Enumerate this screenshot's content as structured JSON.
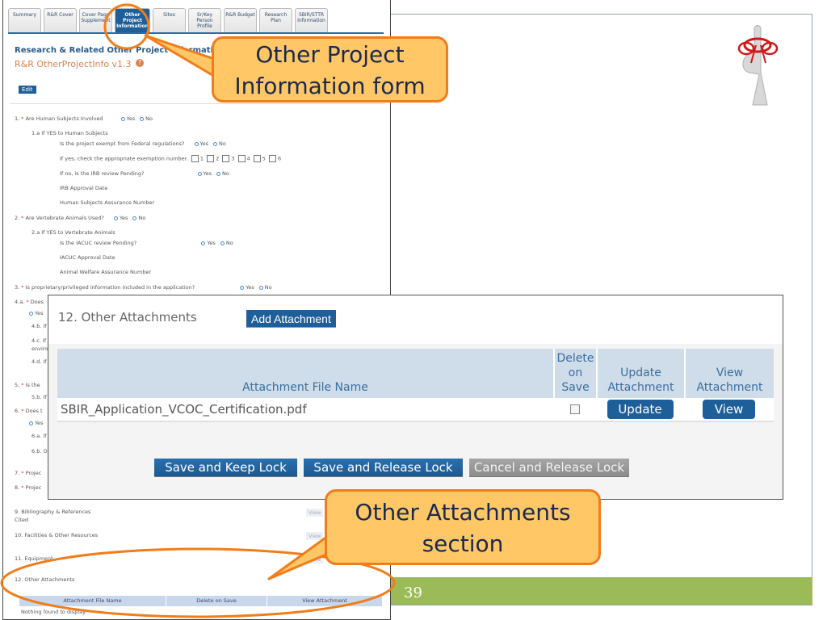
{
  "form": {
    "tabs": [
      {
        "label": "Summary",
        "active": false
      },
      {
        "label": "R&R Cover",
        "active": false
      },
      {
        "label": "Cover Page Supplement",
        "active": false
      },
      {
        "label": "Other Project Information",
        "active": true
      },
      {
        "label": "Sites",
        "active": false
      },
      {
        "label": "Sr/Key Person Profile",
        "active": false
      },
      {
        "label": "R&R Budget",
        "active": false
      },
      {
        "label": "Research Plan",
        "active": false
      },
      {
        "label": "SBIR/STTR Information",
        "active": false
      }
    ],
    "title": "Research & Related Other Project Information",
    "subtitle": "R&R OtherProjectInfo v1.3",
    "help_icon": "?",
    "edit_label": "Edit",
    "yes": "Yes",
    "no": "No",
    "required_mark": "*",
    "questions": {
      "q1": "1.",
      "q1_text": "Are Human Subjects Involved",
      "q1a": "1.a If YES to Human Subjects",
      "q1a_exempt": "Is the project exempt from Federal regulations?",
      "q1a_exemption": "If yes, check the appropriate exemption number.",
      "exemption_numbers": [
        "1",
        "2",
        "3",
        "4",
        "5",
        "6"
      ],
      "q1a_irb": "If no, is the IRB review Pending?",
      "q1a_irb_date": "IRB Approval Date",
      "q1a_assurance": "Human Subjects Assurance Number",
      "q2": "2.",
      "q2_text": "Are Vertebrate Animals Used?",
      "q2a": "2.a If YES to Vertebrate Animals",
      "q2a_iacuc": "Is the IACUC review Pending?",
      "q2a_date": "IACUC Approval Date",
      "q2a_assurance": "Animal Welfare Assurance Number",
      "q3": "3.",
      "q3_text": "Is proprietary/privileged information included in the application?",
      "q4a": "4.a.",
      "q4a_text": "Does",
      "q4a_yes": "Yes",
      "q4b": "4.b. If",
      "q4c": "4.c. If",
      "q4c_2": "enviro",
      "q4d": "4.d. If",
      "q5": "5.",
      "q5_text": "Is the",
      "q5b": "5.b. If",
      "q6": "6.",
      "q6_text": "Does t",
      "q6_yes": "Yes",
      "q6a": "6.a. If",
      "q6b": "6.b. O",
      "q7": "7.",
      "q7_text": "Projec",
      "q8": "8.",
      "q8_text": "Projec",
      "q9": "9. Bibliography & References",
      "q9_2": "Cited",
      "q10": "10. Facilities & Other Resources",
      "q11": "11. Equipment",
      "q12": "12. Other Attachments",
      "view": "View"
    },
    "mini_table": {
      "headers": [
        "Attachment File Name",
        "Delete on Save",
        "View Attachment"
      ],
      "empty": "Nothing found to display."
    }
  },
  "attachments": {
    "title": "12. Other Attachments",
    "add_label": "Add Attachment",
    "headers": {
      "file": "Attachment File Name",
      "delete": "Delete on Save",
      "update": "Update Attachment",
      "view": "View Attachment"
    },
    "rows": [
      {
        "file": "SBIR_Application_VCOC_Certification.pdf",
        "delete_checked": false,
        "update_label": "Update",
        "view_label": "View"
      }
    ],
    "actions": {
      "save_keep": "Save and Keep Lock",
      "save_release": "Save and Release Lock",
      "cancel_release": "Cancel and Release Lock"
    }
  },
  "callouts": {
    "top": [
      "Other Project",
      "Information form"
    ],
    "bottom": [
      "Other Attachments",
      "section"
    ]
  },
  "slide": {
    "number": "39",
    "footer_color": "#9bbb59",
    "accent_orange": "#f07d1a",
    "callout_fill": "#ffc766"
  }
}
